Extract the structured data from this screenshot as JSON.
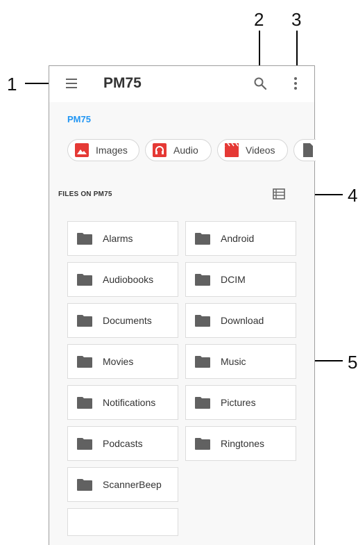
{
  "callouts": [
    "1",
    "2",
    "3",
    "4",
    "5"
  ],
  "appbar": {
    "title": "PM75",
    "menu_icon": "hamburger-menu-icon",
    "search_icon": "search-icon",
    "more_icon": "more-vert-icon"
  },
  "breadcrumb": "PM75",
  "chips": [
    {
      "label": "Images",
      "icon": "image-icon",
      "color": "#e53935"
    },
    {
      "label": "Audio",
      "icon": "headphones-icon",
      "color": "#e53935"
    },
    {
      "label": "Videos",
      "icon": "movie-icon",
      "color": "#e53935"
    },
    {
      "label": "",
      "icon": "document-icon",
      "color": "#616161"
    }
  ],
  "section": {
    "label": "FILES ON PM75",
    "view_toggle_icon": "list-view-icon"
  },
  "folders": [
    "Alarms",
    "Android",
    "Audiobooks",
    "DCIM",
    "Documents",
    "Download",
    "Movies",
    "Music",
    "Notifications",
    "Pictures",
    "Podcasts",
    "Ringtones",
    "ScannerBeep",
    ""
  ],
  "colors": {
    "accent": "#2196f3",
    "folder_icon": "#616161",
    "chip_icon": "#e53935"
  }
}
